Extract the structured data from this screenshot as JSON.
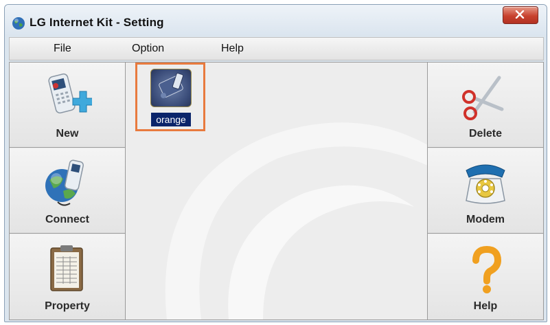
{
  "window": {
    "title": "LG Internet Kit - Setting"
  },
  "menu": [
    "File",
    "Option",
    "Help"
  ],
  "left_panel": [
    {
      "label": "New",
      "icon": "phone-add-icon"
    },
    {
      "label": "Connect",
      "icon": "globe-phone-icon"
    },
    {
      "label": "Property",
      "icon": "clipboard-icon"
    }
  ],
  "right_panel": [
    {
      "label": "Delete",
      "icon": "scissors-icon"
    },
    {
      "label": "Modem",
      "icon": "telephone-icon"
    },
    {
      "label": "Help",
      "icon": "question-icon"
    }
  ],
  "profiles": [
    {
      "label": "orange",
      "selected": true
    }
  ],
  "colors": {
    "selection_border": "#e87a3e",
    "selected_label_bg": "#0a246a",
    "close_button": "#c8422f"
  }
}
